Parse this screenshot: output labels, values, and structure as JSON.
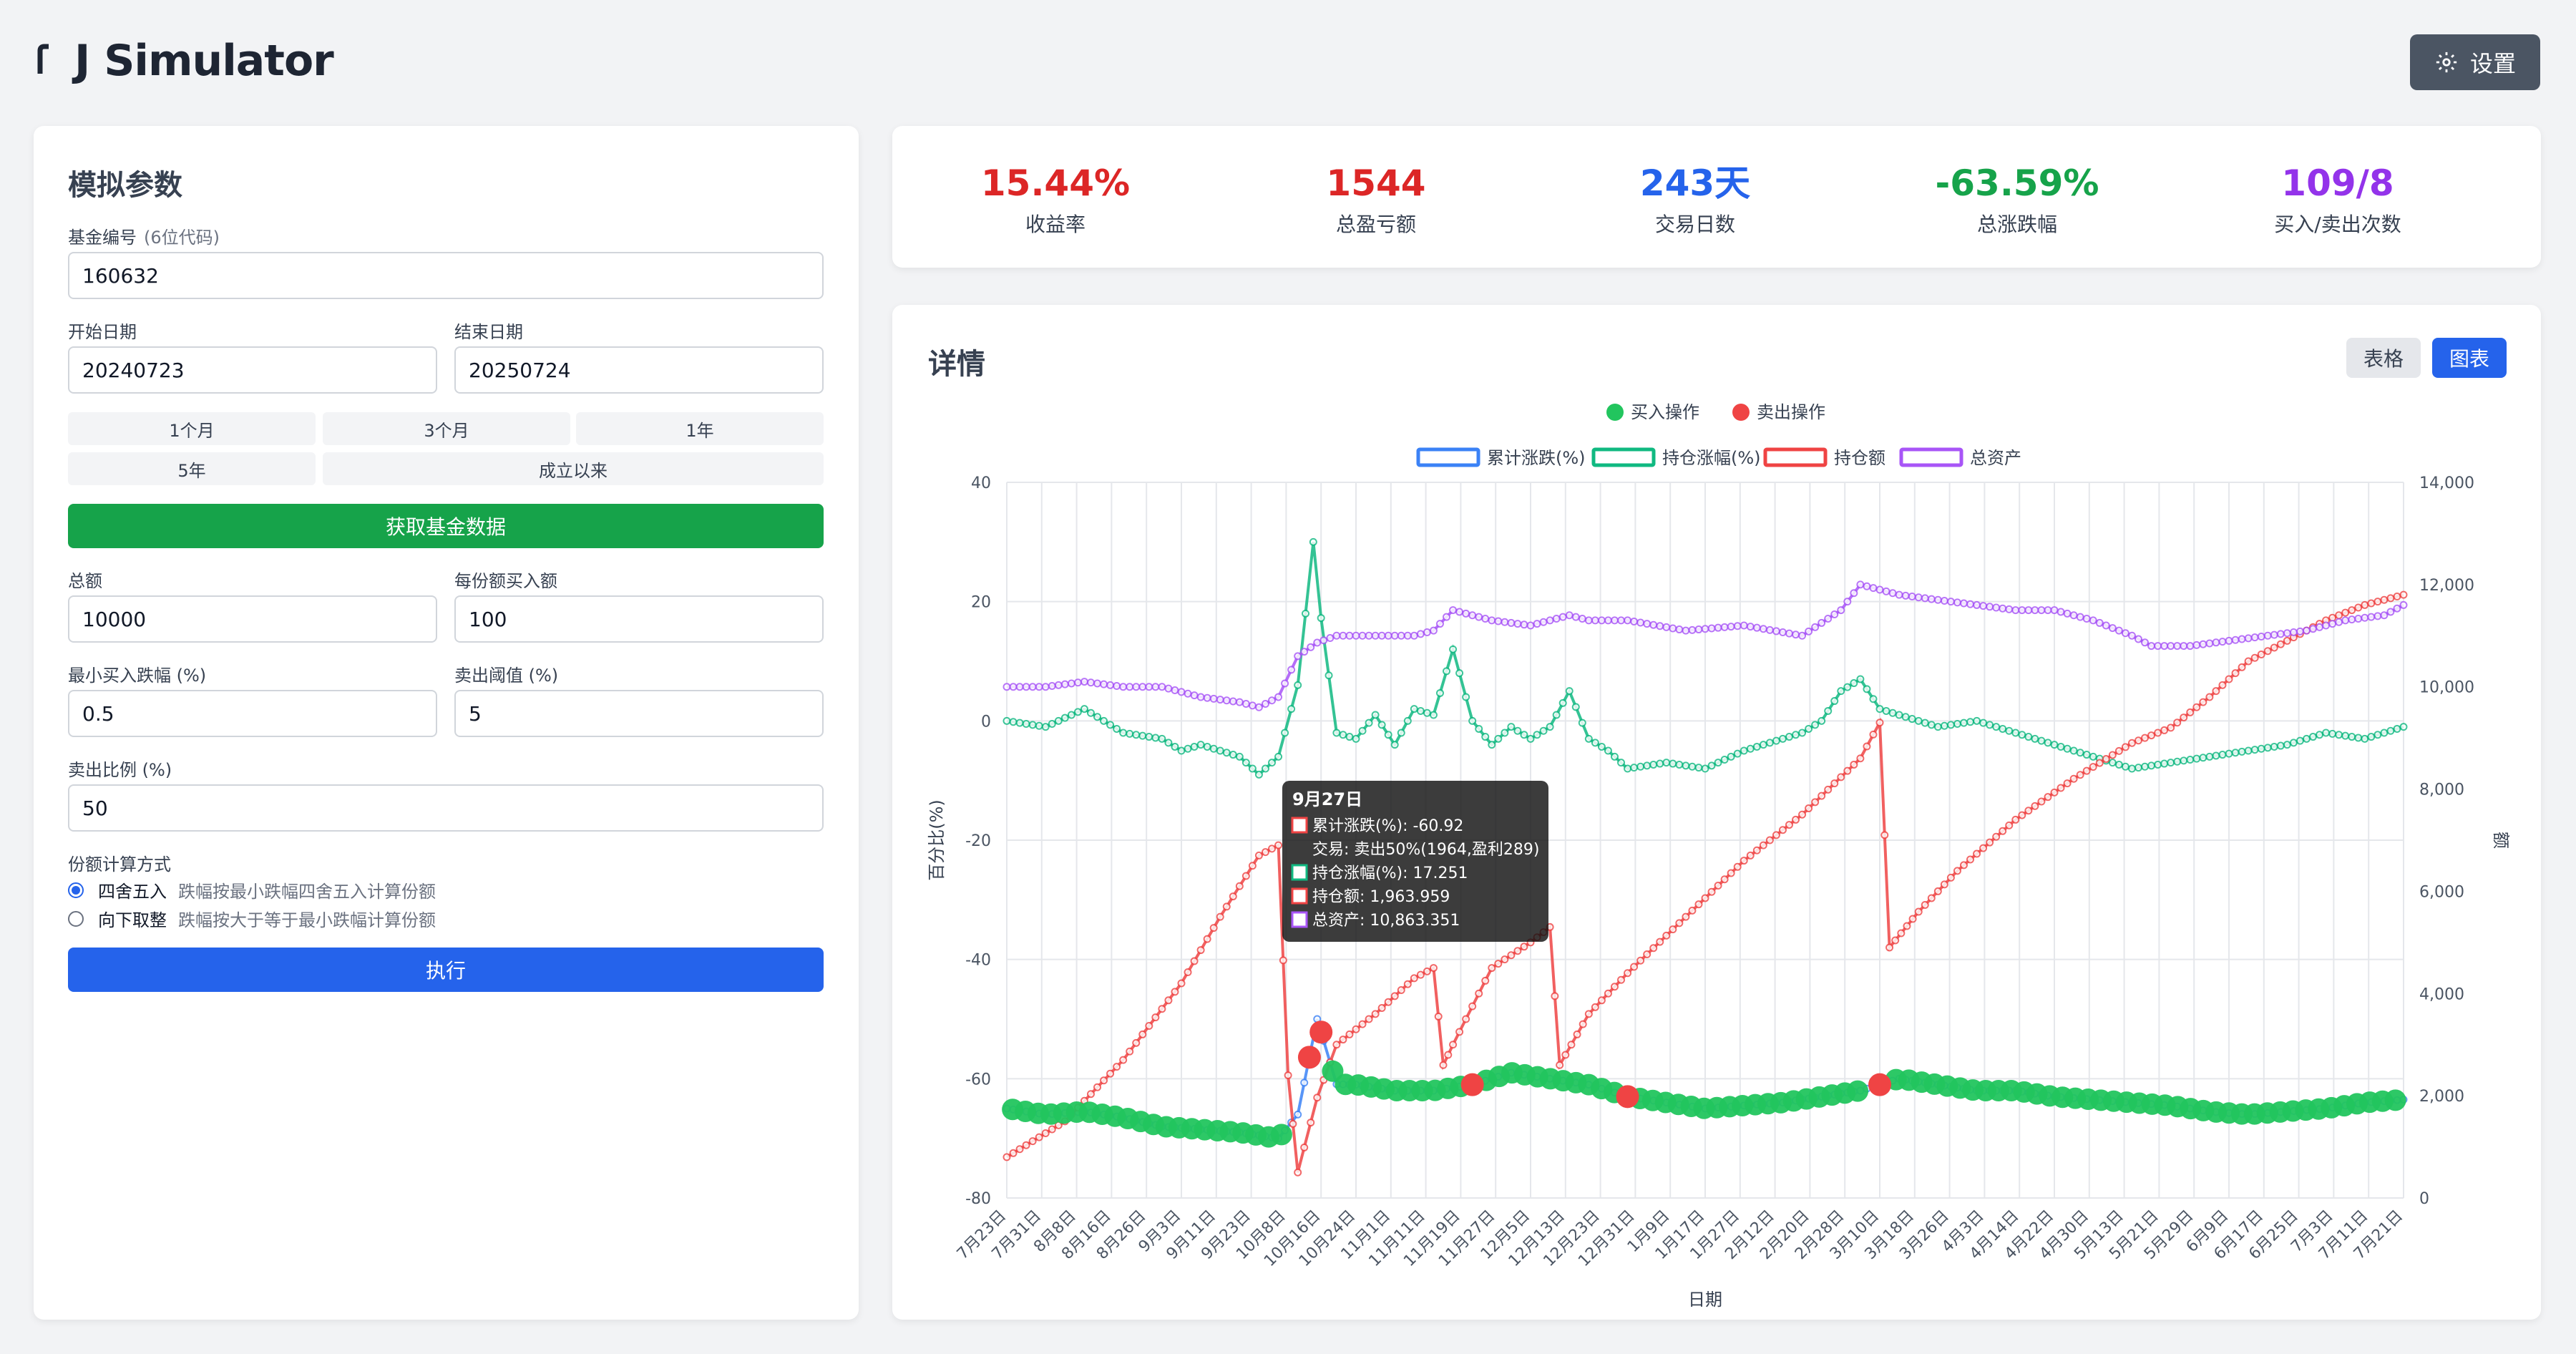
{
  "app": {
    "title": "J Simulator",
    "settings_label": "设置"
  },
  "params": {
    "heading": "模拟参数",
    "fund_code": {
      "label": "基金编号",
      "hint": "(6位代码)",
      "value": "160632"
    },
    "start_date": {
      "label": "开始日期",
      "value": "20240723"
    },
    "end_date": {
      "label": "结束日期",
      "value": "20250724"
    },
    "ranges": [
      "1个月",
      "3个月",
      "1年",
      "5年",
      "成立以来"
    ],
    "fetch_label": "获取基金数据",
    "total": {
      "label": "总额",
      "value": "10000"
    },
    "per_share": {
      "label": "每份额买入额",
      "value": "100"
    },
    "min_drop": {
      "label": "最小买入跌幅 (%)",
      "value": "0.5"
    },
    "sell_threshold": {
      "label": "卖出阈值 (%)",
      "value": "5"
    },
    "sell_ratio": {
      "label": "卖出比例 (%)",
      "value": "50"
    },
    "calc_method": {
      "label": "份额计算方式",
      "options": [
        {
          "name": "四舍五入",
          "desc": "跌幅按最小跌幅四舍五入计算份额",
          "selected": true
        },
        {
          "name": "向下取整",
          "desc": "跌幅按大于等于最小跌幅计算份额",
          "selected": false
        }
      ]
    },
    "run_label": "执行"
  },
  "stats": [
    {
      "value": "15.44%",
      "label": "收益率",
      "color": "#dc2626"
    },
    {
      "value": "1544",
      "label": "总盈亏额",
      "color": "#dc2626"
    },
    {
      "value": "243天",
      "label": "交易日数",
      "color": "#2563eb"
    },
    {
      "value": "-63.59%",
      "label": "总涨跌幅",
      "color": "#16a34a"
    },
    {
      "value": "109/8",
      "label": "买入/卖出次数",
      "color": "#9333ea"
    }
  ],
  "detail": {
    "heading": "详情",
    "table_label": "表格",
    "chart_label": "图表"
  },
  "colors": {
    "blue": "#2563eb",
    "green": "#16a34a",
    "red": "#dc2626",
    "purple": "#9333ea",
    "dark": "#4b5563"
  },
  "chart_data": {
    "type": "line",
    "x_ticks": [
      "7月23日",
      "7月31日",
      "8月8日",
      "8月16日",
      "8月26日",
      "9月3日",
      "9月11日",
      "9月23日",
      "10月8日",
      "10月16日",
      "10月24日",
      "11月1日",
      "11月11日",
      "11月19日",
      "11月27日",
      "12月5日",
      "12月13日",
      "12月23日",
      "12月31日",
      "1月9日",
      "1月17日",
      "1月27日",
      "2月12日",
      "2月20日",
      "2月28日",
      "3月10日",
      "3月18日",
      "3月26日",
      "4月3日",
      "4月14日",
      "4月22日",
      "4月30日",
      "5月13日",
      "5月21日",
      "5月29日",
      "6月9日",
      "6月17日",
      "6月25日",
      "7月3日",
      "7月11日",
      "7月21日"
    ],
    "xlabel": "日期",
    "ylabel_left": "百分比(%)",
    "ylabel_right": "额",
    "y_left": {
      "min": -80,
      "max": 40,
      "ticks": [
        40,
        20,
        0,
        -20,
        -40,
        -60,
        -80
      ]
    },
    "y_right": {
      "min": 0,
      "max": 14000,
      "ticks": [
        "14,000",
        "12,000",
        "10,000",
        "8,000",
        "6,000",
        "4,000",
        "2,000",
        "0"
      ]
    },
    "marker_legend": [
      {
        "name": "买入操作",
        "color": "#22c55e"
      },
      {
        "name": "卖出操作",
        "color": "#ef4444"
      }
    ],
    "series": [
      {
        "name": "累计涨跌(%)",
        "axis": "left",
        "color": "#3b82f6",
        "points": [
          [
            0,
            -65
          ],
          [
            2,
            -66
          ],
          [
            4,
            -65.5
          ],
          [
            6,
            -66.5
          ],
          [
            8,
            -68
          ],
          [
            10,
            -68.5
          ],
          [
            12,
            -69
          ],
          [
            14,
            -70
          ],
          [
            15,
            -66
          ],
          [
            16,
            -50
          ],
          [
            17,
            -60.92
          ],
          [
            18,
            -61
          ],
          [
            20,
            -62
          ],
          [
            22,
            -62
          ],
          [
            24,
            -61
          ],
          [
            26,
            -59
          ],
          [
            28,
            -60
          ],
          [
            30,
            -61
          ],
          [
            32,
            -63
          ],
          [
            34,
            -64
          ],
          [
            36,
            -65
          ],
          [
            38,
            -64.5
          ],
          [
            40,
            -64
          ],
          [
            42,
            -63
          ],
          [
            44,
            -62
          ],
          [
            46,
            -60
          ],
          [
            48,
            -61
          ],
          [
            50,
            -62
          ],
          [
            52,
            -62
          ],
          [
            54,
            -63
          ],
          [
            56,
            -63.5
          ],
          [
            58,
            -64
          ],
          [
            60,
            -64.5
          ],
          [
            62,
            -65.5
          ],
          [
            64,
            -66
          ],
          [
            66,
            -65.5
          ],
          [
            68,
            -65
          ],
          [
            70,
            -64
          ],
          [
            72,
            -63.5
          ]
        ]
      },
      {
        "name": "持仓涨幅(%)",
        "axis": "left",
        "color": "#10b981",
        "points": [
          [
            0,
            0
          ],
          [
            2,
            -1
          ],
          [
            4,
            2
          ],
          [
            6,
            -2
          ],
          [
            8,
            -3
          ],
          [
            9,
            -5
          ],
          [
            10,
            -4
          ],
          [
            12,
            -6
          ],
          [
            13,
            -9
          ],
          [
            14,
            -6
          ],
          [
            15,
            6
          ],
          [
            15.8,
            30
          ],
          [
            16.2,
            17.251
          ],
          [
            17,
            -2
          ],
          [
            18,
            -3
          ],
          [
            19,
            1
          ],
          [
            20,
            -4
          ],
          [
            21,
            2
          ],
          [
            22,
            1
          ],
          [
            23,
            12
          ],
          [
            24,
            0
          ],
          [
            25,
            -4
          ],
          [
            26,
            -1
          ],
          [
            27,
            -3
          ],
          [
            28,
            -1
          ],
          [
            29,
            5
          ],
          [
            30,
            -3
          ],
          [
            31,
            -5
          ],
          [
            32,
            -8
          ],
          [
            34,
            -7
          ],
          [
            36,
            -8
          ],
          [
            38,
            -5
          ],
          [
            40,
            -3
          ],
          [
            41,
            -2
          ],
          [
            42,
            0
          ],
          [
            43,
            5
          ],
          [
            44,
            7
          ],
          [
            45,
            2
          ],
          [
            46,
            1
          ],
          [
            48,
            -1
          ],
          [
            50,
            0
          ],
          [
            52,
            -2
          ],
          [
            54,
            -4
          ],
          [
            56,
            -6
          ],
          [
            58,
            -8
          ],
          [
            60,
            -7
          ],
          [
            62,
            -6
          ],
          [
            64,
            -5
          ],
          [
            66,
            -4
          ],
          [
            68,
            -2
          ],
          [
            70,
            -3
          ],
          [
            72,
            -1
          ]
        ]
      },
      {
        "name": "持仓额",
        "axis": "right",
        "color": "#ef4444",
        "points": [
          [
            0,
            800
          ],
          [
            3,
            1500
          ],
          [
            6,
            2700
          ],
          [
            9,
            4200
          ],
          [
            11,
            5500
          ],
          [
            13,
            6700
          ],
          [
            14,
            6900
          ],
          [
            14.5,
            2400
          ],
          [
            15,
            500
          ],
          [
            16,
            1963.959
          ],
          [
            17,
            3000
          ],
          [
            19,
            3600
          ],
          [
            21,
            4300
          ],
          [
            22,
            4500
          ],
          [
            22.5,
            2600
          ],
          [
            23,
            3000
          ],
          [
            25,
            4500
          ],
          [
            27,
            5000
          ],
          [
            28,
            5300
          ],
          [
            28.5,
            2600
          ],
          [
            30,
            3600
          ],
          [
            32,
            4400
          ],
          [
            35,
            5500
          ],
          [
            38,
            6600
          ],
          [
            41,
            7500
          ],
          [
            44,
            8600
          ],
          [
            45,
            9300
          ],
          [
            45.5,
            4900
          ],
          [
            47,
            5600
          ],
          [
            49,
            6400
          ],
          [
            52,
            7400
          ],
          [
            55,
            8200
          ],
          [
            58,
            8900
          ],
          [
            60,
            9200
          ],
          [
            62,
            9800
          ],
          [
            64,
            10500
          ],
          [
            66,
            10900
          ],
          [
            68,
            11300
          ],
          [
            70,
            11600
          ],
          [
            72,
            11800
          ]
        ]
      },
      {
        "name": "总资产",
        "axis": "right",
        "color": "#a855f7",
        "points": [
          [
            0,
            10000
          ],
          [
            2,
            10000
          ],
          [
            4,
            10100
          ],
          [
            6,
            10000
          ],
          [
            8,
            10000
          ],
          [
            10,
            9800
          ],
          [
            12,
            9700
          ],
          [
            13,
            9600
          ],
          [
            14,
            9800
          ],
          [
            15,
            10600
          ],
          [
            16,
            10863.351
          ],
          [
            17,
            11000
          ],
          [
            19,
            11000
          ],
          [
            21,
            11000
          ],
          [
            22,
            11100
          ],
          [
            23,
            11500
          ],
          [
            25,
            11300
          ],
          [
            27,
            11200
          ],
          [
            29,
            11400
          ],
          [
            30,
            11300
          ],
          [
            32,
            11300
          ],
          [
            35,
            11100
          ],
          [
            38,
            11200
          ],
          [
            41,
            11000
          ],
          [
            43,
            11500
          ],
          [
            44,
            12000
          ],
          [
            46,
            11800
          ],
          [
            48,
            11700
          ],
          [
            50,
            11600
          ],
          [
            52,
            11500
          ],
          [
            54,
            11500
          ],
          [
            56,
            11300
          ],
          [
            58,
            11000
          ],
          [
            59,
            10800
          ],
          [
            61,
            10800
          ],
          [
            63,
            10900
          ],
          [
            65,
            11000
          ],
          [
            67,
            11100
          ],
          [
            69,
            11300
          ],
          [
            71,
            11400
          ],
          [
            72,
            11600
          ]
        ]
      }
    ],
    "markers_note": "buy markers shown as green dots, sell markers as red dots",
    "tooltip": {
      "title": "9月27日",
      "lines": [
        {
          "text": "累计涨跌(%): -60.92",
          "color": "#ef4444"
        },
        {
          "text": "交易: 卖出50%(1964,盈利289)",
          "color": ""
        },
        {
          "text": "持仓涨幅(%): 17.251",
          "color": "#10b981"
        },
        {
          "text": "持仓额: 1,963.959",
          "color": "#ef4444"
        },
        {
          "text": "总资产: 10,863.351",
          "color": "#a855f7"
        }
      ]
    }
  }
}
